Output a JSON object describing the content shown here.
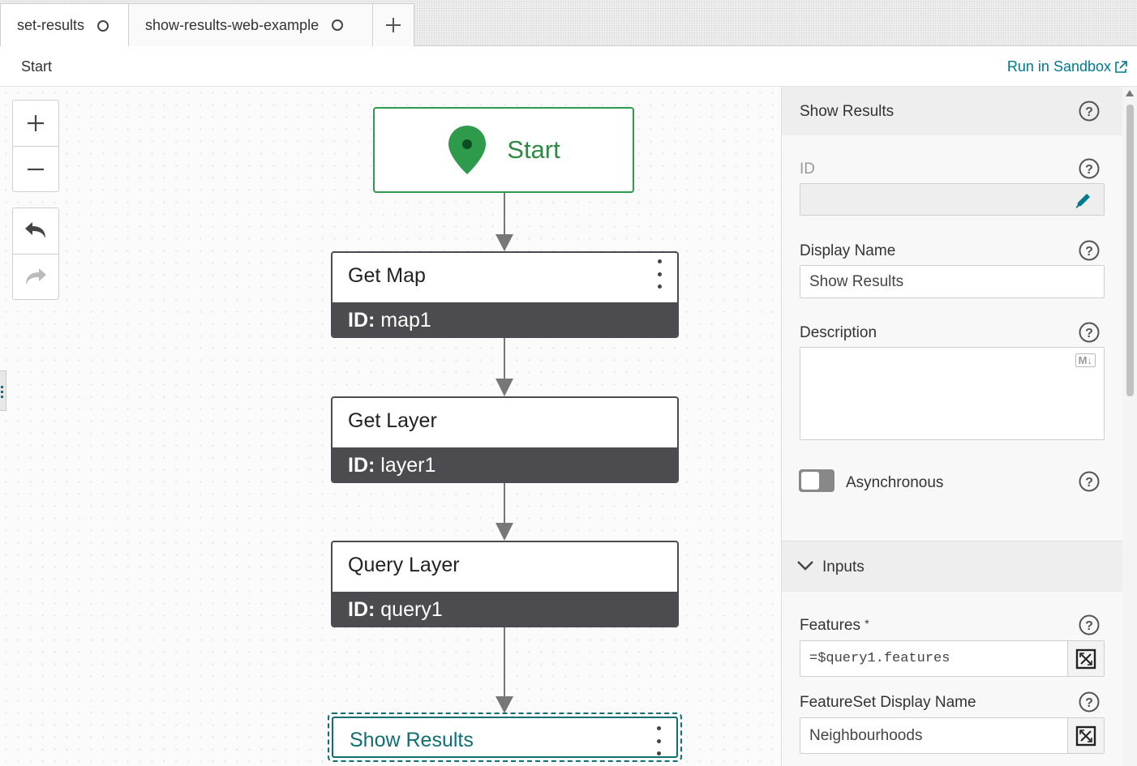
{
  "tabs": [
    {
      "label": "set-results",
      "active": true
    },
    {
      "label": "show-results-web-example",
      "active": false
    }
  ],
  "add_tab_icon": "plus-icon",
  "breadcrumb": {
    "current": "Start"
  },
  "run_sandbox": {
    "label": "Run in Sandbox",
    "icon": "external-link-icon",
    "color": "#00798c"
  },
  "canvas_controls": {
    "zoom_in_icon": "plus-icon",
    "zoom_out_icon": "minus-icon",
    "undo_icon": "undo-icon",
    "redo_icon": "redo-icon"
  },
  "flow": {
    "start": {
      "label": "Start",
      "icon": "map-pin-icon",
      "color": "#2e9a4b"
    },
    "steps": [
      {
        "title": "Get Map",
        "id_label": "ID:",
        "id_value": "map1"
      },
      {
        "title": "Get Layer",
        "id_label": "ID:",
        "id_value": "layer1"
      },
      {
        "title": "Query Layer",
        "id_label": "ID:",
        "id_value": "query1"
      }
    ],
    "selected_step": {
      "title": "Show Results",
      "color": "#0f6f72"
    }
  },
  "panel": {
    "title": "Show Results",
    "id_label": "ID",
    "id_value": "",
    "display_name_label": "Display Name",
    "display_name_value": "Show Results",
    "description_label": "Description",
    "description_value": "",
    "markdown_badge": "M↓",
    "async_label": "Asynchronous",
    "async_on": false,
    "inputs_section": "Inputs",
    "features_label": "Features",
    "features_required": "*",
    "features_value": "=$query1.features",
    "featureset_label": "FeatureSet Display Name",
    "featureset_value": "Neighbourhoods"
  }
}
